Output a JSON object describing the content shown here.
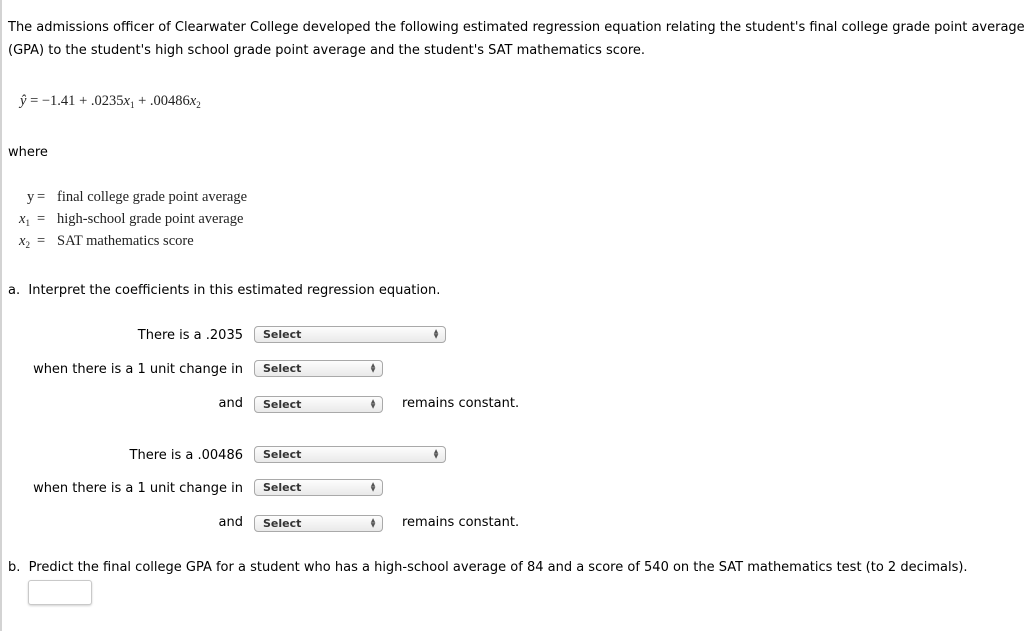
{
  "intro": {
    "line1": "The admissions officer of Clearwater College developed the following estimated regression equation relating the student's final college grade point average",
    "line2": "(GPA) to the student's high school grade point average and the student's SAT mathematics score."
  },
  "equation": {
    "lhs": "ŷ",
    "equals": "=",
    "intercept": "−1.41",
    "plus1": "+",
    "coef1": ".0235",
    "var1": "x",
    "sub1": "1",
    "plus2": "+",
    "coef2": ".00486",
    "var2": "x",
    "sub2": "2"
  },
  "where_label": "where",
  "definitions": [
    {
      "symbol": "y",
      "sub": "",
      "equals": "=",
      "text": "final college grade point average"
    },
    {
      "symbol": "x",
      "sub": "1",
      "equals": "=",
      "text": "high-school grade point average"
    },
    {
      "symbol": "x",
      "sub": "2",
      "equals": "=",
      "text": "SAT mathematics score"
    }
  ],
  "part_a": {
    "label": "a.",
    "question": "Interpret the coefficients in this estimated regression equation.",
    "blocks": [
      {
        "there_is": "There is a .2035",
        "when_change": "when there is a 1 unit change in",
        "and": "and",
        "remains": "remains constant.",
        "select1": "Select",
        "select2": "Select",
        "select3": "Select"
      },
      {
        "there_is": "There is a .00486",
        "when_change": "when there is a 1 unit change in",
        "and": "and",
        "remains": "remains constant.",
        "select1": "Select",
        "select2": "Select",
        "select3": "Select"
      }
    ]
  },
  "part_b": {
    "label": "b.",
    "question": "Predict the final college GPA for a student who has a high-school average of 84 and a score of 540 on the SAT mathematics test (to 2 decimals).",
    "answer_value": "",
    "answer_placeholder": ""
  },
  "icons": {
    "select_arrows": "▲▼"
  }
}
